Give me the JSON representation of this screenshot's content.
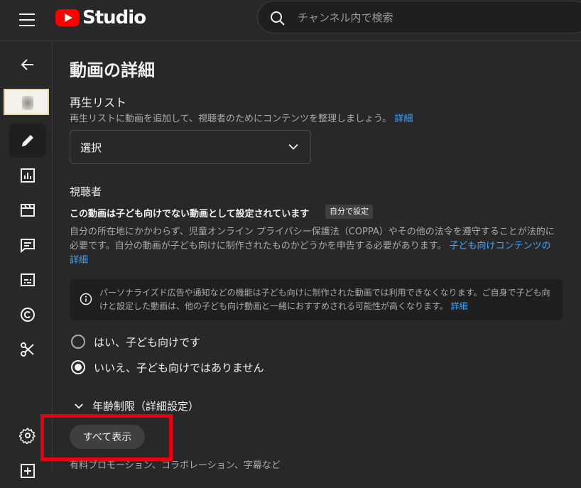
{
  "header": {
    "app_name": "Studio",
    "search_placeholder": "チャンネル内で検索"
  },
  "sidebar": {
    "items": [
      {
        "name": "back",
        "icon": "back-arrow-icon"
      },
      {
        "name": "thumbnail",
        "icon": "video-thumbnail"
      },
      {
        "name": "details",
        "icon": "pencil-icon",
        "active": true
      },
      {
        "name": "analytics",
        "icon": "analytics-icon"
      },
      {
        "name": "editor",
        "icon": "clapperboard-icon"
      },
      {
        "name": "comments",
        "icon": "comment-icon"
      },
      {
        "name": "subtitles",
        "icon": "subtitles-icon"
      },
      {
        "name": "copyright",
        "icon": "copyright-icon"
      },
      {
        "name": "clips",
        "icon": "scissors-icon"
      },
      {
        "name": "settings",
        "icon": "gear-icon"
      },
      {
        "name": "add",
        "icon": "plus-box-icon"
      }
    ]
  },
  "main": {
    "page_title": "動画の詳細",
    "playlist": {
      "title": "再生リスト",
      "description": "再生リストに動画を追加して、視聴者のためにコンテンツを整理しましょう。",
      "link": "詳細",
      "select_value": "選択"
    },
    "audience": {
      "title": "視聴者",
      "status": "この動画は子ども向けでない動画として設定されています",
      "chip": "自分で設定",
      "paragraph": "自分の所在地にかかわらず、児童オンライン プライバシー保護法（COPPA）やその他の法令を遵守することが法的に必要です。自分の動画が子ども向けに制作されたものかどうかを申告する必要があります。",
      "paragraph_link": "子ども向けコンテンツの詳細",
      "info": "パーソナライズド広告や通知などの機能は子ども向けに制作された動画では利用できなくなります。ご自身で子ども向けと設定した動画は、他の子ども向け動画と一緒におすすめされる可能性が高くなります。",
      "info_link": "詳細",
      "options": [
        {
          "label": "はい、子ども向けです",
          "selected": false
        },
        {
          "label": "いいえ、子ども向けではありません",
          "selected": true
        }
      ]
    },
    "age_restriction": "年齢制限（詳細設定）",
    "show_all": "すべて表示",
    "bottom_text": "有料プロモーション、コラボレーション、字幕など"
  },
  "colors": {
    "background": "#282828",
    "accent_link": "#3ea6ff",
    "highlight": "#e60012",
    "brand": "#ff0000"
  }
}
